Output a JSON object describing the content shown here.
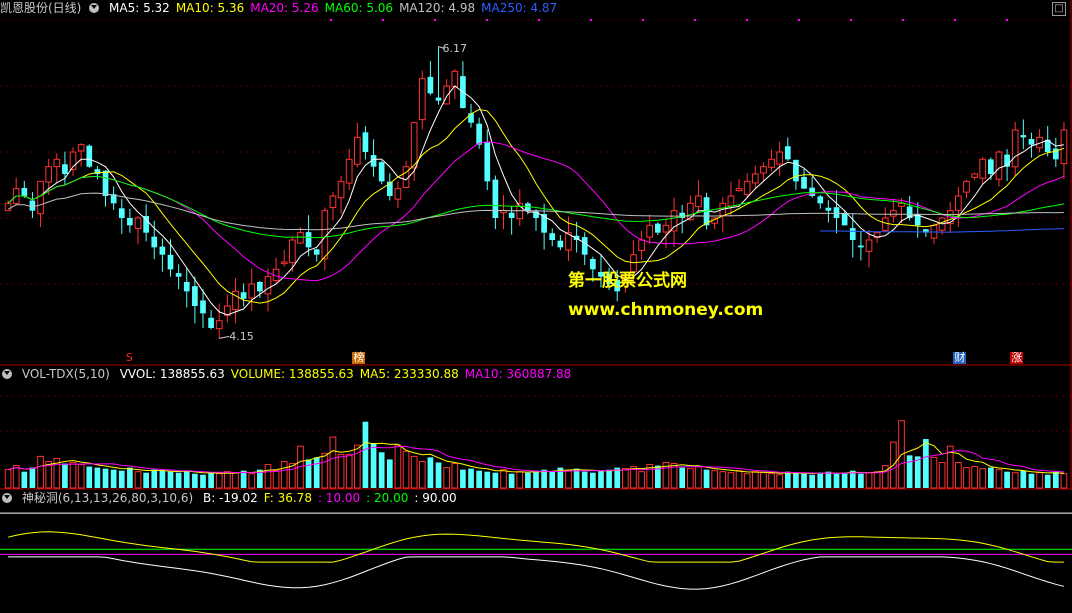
{
  "main": {
    "title": "凯恩股份(日线)",
    "ma": [
      {
        "label": "MA5: 5.32",
        "color": "#ffffff"
      },
      {
        "label": "MA10: 5.36",
        "color": "#ffff00"
      },
      {
        "label": "MA20: 5.26",
        "color": "#ff00ff"
      },
      {
        "label": "MA60: 5.06",
        "color": "#00ff00"
      },
      {
        "label": "MA120: 4.98",
        "color": "#c0c0c0"
      },
      {
        "label": "MA250: 4.87",
        "color": "#2d5cff"
      }
    ],
    "high_label": "6.17",
    "low_label": "4.15",
    "signals": [
      {
        "text": "S",
        "color": "#ff2020",
        "bg": "transparent"
      },
      {
        "text": "榜",
        "color": "#ffffff",
        "bg": "#c86a00"
      },
      {
        "text": "财",
        "color": "#ffffff",
        "bg": "#2060c0"
      },
      {
        "text": "涨",
        "color": "#ffffff",
        "bg": "#c00000"
      }
    ],
    "watermark1": "第一股票公式网",
    "watermark2": "www.chnmoney.com",
    "max_icon": "□"
  },
  "vol": {
    "title": "VOL-TDX(5,10)",
    "items": [
      {
        "label": "VVOL: 138855.63",
        "color": "#ffffff"
      },
      {
        "label": "VOLUME: 138855.63",
        "color": "#ffff00"
      },
      {
        "label": "MA5: 233330.88",
        "color": "#ffff00"
      },
      {
        "label": "MA10: 360887.88",
        "color": "#ff00ff"
      }
    ]
  },
  "ind": {
    "title": "神秘洞(6,13,13,26,80,3,10,6)",
    "items": [
      {
        "label": "B: -19.02",
        "color": "#ffffff"
      },
      {
        "label": "F: 36.78",
        "color": "#ffff00"
      },
      {
        "label": ": 10.00",
        "color": "#ff00ff"
      },
      {
        "label": ": 20.00",
        "color": "#00ff00"
      },
      {
        "label": ": 90.00",
        "color": "#ffffff"
      }
    ]
  },
  "chart_data": {
    "type": "candlestick",
    "price_range": [
      4.05,
      6.3
    ],
    "closes": [
      5.05,
      5.15,
      5.1,
      5.0,
      5.2,
      5.3,
      5.35,
      5.25,
      5.4,
      5.45,
      5.3,
      5.25,
      5.1,
      5.05,
      4.95,
      4.9,
      4.95,
      4.85,
      4.75,
      4.7,
      4.6,
      4.55,
      4.45,
      4.35,
      4.3,
      4.2,
      4.25,
      4.35,
      4.45,
      4.4,
      4.5,
      4.45,
      4.55,
      4.6,
      4.65,
      4.8,
      4.85,
      4.75,
      4.7,
      5.0,
      5.1,
      5.2,
      5.35,
      5.5,
      5.4,
      5.3,
      5.2,
      5.1,
      5.15,
      5.3,
      5.6,
      5.9,
      5.8,
      5.75,
      5.85,
      5.95,
      5.7,
      5.6,
      5.45,
      5.2,
      4.95,
      5.0,
      4.95,
      5.05,
      5.0,
      4.95,
      4.85,
      4.8,
      4.75,
      4.85,
      4.8,
      4.7,
      4.6,
      4.55,
      4.5,
      4.45,
      4.55,
      4.7,
      4.8,
      4.9,
      4.85,
      4.9,
      5.0,
      4.95,
      5.05,
      5.1,
      4.9,
      4.95,
      5.05,
      5.1,
      5.15,
      5.2,
      5.25,
      5.3,
      5.35,
      5.4,
      5.35,
      5.2,
      5.15,
      5.1,
      5.05,
      5.0,
      4.95,
      4.9,
      4.8,
      4.75,
      4.8,
      4.85,
      4.95,
      5.0,
      5.05,
      4.95,
      4.9,
      4.85,
      4.9,
      4.95,
      5.0,
      5.1,
      5.2,
      5.25,
      5.35,
      5.25,
      5.4,
      5.3,
      5.55,
      5.5,
      5.45,
      5.5,
      5.4,
      5.35,
      5.55
    ],
    "volume_range": [
      0,
      1000000
    ],
    "volumes": [
      180000,
      220000,
      160000,
      200000,
      310000,
      260000,
      290000,
      240000,
      250000,
      230000,
      210000,
      200000,
      190000,
      180000,
      170000,
      200000,
      160000,
      150000,
      180000,
      170000,
      160000,
      150000,
      170000,
      140000,
      130000,
      150000,
      140000,
      160000,
      150000,
      170000,
      140000,
      180000,
      230000,
      170000,
      260000,
      240000,
      410000,
      280000,
      300000,
      340000,
      500000,
      330000,
      330000,
      420000,
      650000,
      440000,
      350000,
      280000,
      420000,
      360000,
      310000,
      260000,
      300000,
      250000,
      200000,
      240000,
      180000,
      190000,
      170000,
      160000,
      150000,
      180000,
      140000,
      160000,
      150000,
      170000,
      180000,
      160000,
      200000,
      170000,
      190000,
      160000,
      150000,
      170000,
      180000,
      200000,
      190000,
      210000,
      160000,
      230000,
      220000,
      250000,
      240000,
      200000,
      190000,
      210000,
      180000,
      170000,
      160000,
      150000,
      170000,
      140000,
      160000,
      150000,
      140000,
      130000,
      160000,
      150000,
      140000,
      130000,
      150000,
      160000,
      140000,
      150000,
      170000,
      140000,
      150000,
      160000,
      220000,
      450000,
      660000,
      320000,
      310000,
      480000,
      300000,
      250000,
      410000,
      250000,
      200000,
      210000,
      190000,
      200000,
      180000,
      160000,
      150000,
      170000,
      140000,
      150000,
      130000,
      160000,
      140000
    ],
    "indicator_range": [
      -100,
      100
    ],
    "levels": [
      10,
      20,
      90
    ]
  }
}
